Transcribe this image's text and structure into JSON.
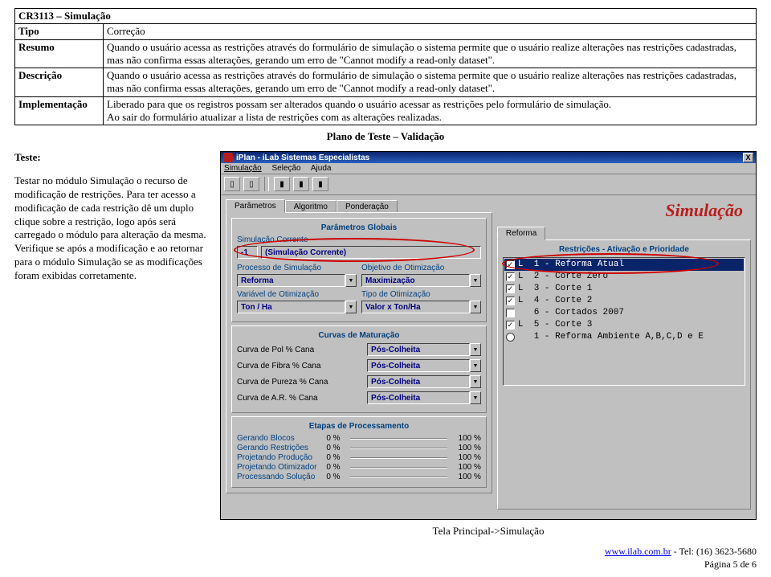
{
  "doc": {
    "cr": "CR3113 – Simulação",
    "rows": {
      "tipo_label": "Tipo",
      "tipo_value": "Correção",
      "resumo_label": "Resumo",
      "resumo_value": "Quando o usuário acessa as restrições através do formulário de simulação o sistema permite que o usuário realize alterações nas restrições cadastradas, mas não confirma essas alterações, gerando um erro de \"Cannot modify a read-only dataset\".",
      "descricao_label": "Descrição",
      "descricao_value": "Quando o usuário acessa as restrições através do formulário de simulação o sistema permite que o usuário realize alterações nas restrições cadastradas, mas não confirma essas alterações, gerando um erro de \"Cannot modify a read-only dataset\".",
      "impl_label": "Implementação",
      "impl_value": "Liberado para que os registros possam ser alterados quando o usuário acessar as restrições pelo formulário de simulação.\nAo sair do formulário atualizar a lista de restrições com as alterações realizadas."
    },
    "plan_title": "Plano de Teste – Validação",
    "teste_label": "Teste:",
    "teste_body": "Testar no módulo Simulação o recurso de modificação de restrições. Para ter acesso a modificação de cada restrição dê um duplo clique sobre a restrição, logo após será carregado o módulo para alteração da mesma. Verifique se após a modificação e ao retornar para o módulo Simulação se as modificações foram exibidas corretamente."
  },
  "win": {
    "title": "iPlan - iLab Sistemas Especialistas",
    "close": "X",
    "menu": {
      "m1": "Simulação",
      "m2": "Seleção",
      "m3": "Ajuda"
    },
    "toolbar": {
      "new": "▯",
      "open": "▯",
      "sep": "│",
      "b3": "I",
      "b4": "I",
      "b5": "I"
    },
    "brand": "Simulação",
    "tabs": {
      "t1": "Parâmetros",
      "t2": "Algoritmo",
      "t3": "Ponderação",
      "tR": "Reforma"
    },
    "globais": {
      "title": "Parâmetros Globais",
      "sim_corrente_lbl": "Simulação Corrente",
      "sim_idx": "-1",
      "sim_name": "(Simulação Corrente)",
      "proc_lbl": "Processo de Simulação",
      "proc_val": "Reforma",
      "obj_lbl": "Objetivo de Otimização",
      "obj_val": "Maximização",
      "var_lbl": "Variável de Otimização",
      "var_val": "Ton / Ha",
      "tipo_lbl": "Tipo de Otimização",
      "tipo_val": "Valor x Ton/Ha",
      "dd": "▼"
    },
    "curvas": {
      "title": "Curvas de Maturação",
      "rows": [
        {
          "lbl": "Curva de Pol % Cana",
          "val": "Pós-Colheita"
        },
        {
          "lbl": "Curva de Fibra % Cana",
          "val": "Pós-Colheita"
        },
        {
          "lbl": "Curva de Pureza % Cana",
          "val": "Pós-Colheita"
        },
        {
          "lbl": "Curva de A.R. % Cana",
          "val": "Pós-Colheita"
        }
      ],
      "dd": "▼"
    },
    "etapas": {
      "title": "Etapas de Processamento",
      "rows": [
        "Gerando Blocos",
        "Gerando Restrições",
        "Projetando Produção",
        "Projetando Otimizador",
        "Processando Solução"
      ],
      "p0": "0 %",
      "p100": "100 %"
    },
    "reforma": {
      "title": "Restrições - Ativação e Prioridade",
      "items": [
        {
          "t": "chk",
          "c": true,
          "txt": "L  1 - Reforma Atual",
          "sel": true
        },
        {
          "t": "chk",
          "c": true,
          "txt": "L  2 - Corte Zero"
        },
        {
          "t": "chk",
          "c": true,
          "txt": "L  3 - Corte 1"
        },
        {
          "t": "chk",
          "c": true,
          "txt": "L  4 - Corte 2"
        },
        {
          "t": "chk",
          "c": false,
          "txt": "   6 - Cortados 2007"
        },
        {
          "t": "chk",
          "c": true,
          "txt": "L  5 - Corte 3"
        },
        {
          "t": "rdo",
          "c": false,
          "txt": "   1 - Reforma Ambiente A,B,C,D e E"
        }
      ]
    }
  },
  "caption": "Tela Principal->Simulação",
  "footer": {
    "link": "www.ilab.com.br",
    "tel": " - Tel: (16) 3623-5680",
    "page": "Página 5 de 6"
  }
}
